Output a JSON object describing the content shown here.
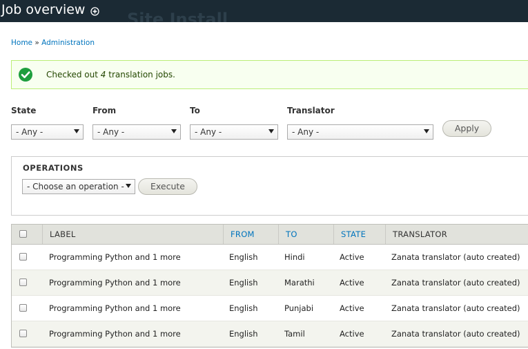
{
  "header": {
    "title": "Job overview",
    "site_name": "Site Install"
  },
  "breadcrumb": {
    "home": "Home",
    "separator": "»",
    "admin": "Administration"
  },
  "status": {
    "prefix": "Checked out ",
    "count": "4",
    "suffix": " translation jobs."
  },
  "filters": {
    "state": {
      "label": "State",
      "value": "- Any -"
    },
    "from": {
      "label": "From",
      "value": "- Any -"
    },
    "to": {
      "label": "To",
      "value": "- Any -"
    },
    "translator": {
      "label": "Translator",
      "value": "- Any -"
    },
    "apply_label": "Apply"
  },
  "operations": {
    "legend": "OPERATIONS",
    "select_value": "- Choose an operation -",
    "execute_label": "Execute"
  },
  "table": {
    "columns": [
      "LABEL",
      "FROM",
      "TO",
      "STATE",
      "TRANSLATOR"
    ],
    "rows": [
      {
        "label": "Programming Python and 1 more",
        "from": "English",
        "to": "Hindi",
        "state": "Active",
        "translator": "Zanata translator (auto created)"
      },
      {
        "label": "Programming Python and 1 more",
        "from": "English",
        "to": "Marathi",
        "state": "Active",
        "translator": "Zanata translator (auto created)"
      },
      {
        "label": "Programming Python and 1 more",
        "from": "English",
        "to": "Punjabi",
        "state": "Active",
        "translator": "Zanata translator (auto created)"
      },
      {
        "label": "Programming Python and 1 more",
        "from": "English",
        "to": "Tamil",
        "state": "Active",
        "translator": "Zanata translator (auto created)"
      }
    ]
  },
  "colors": {
    "header_bg": "#1b2a34",
    "link": "#0074bd",
    "status_bg": "#f8fff0",
    "status_icon": "#1e9e3e"
  },
  "icons": {
    "shortcut": "add-shortcut-icon",
    "status": "check-circle-icon"
  }
}
